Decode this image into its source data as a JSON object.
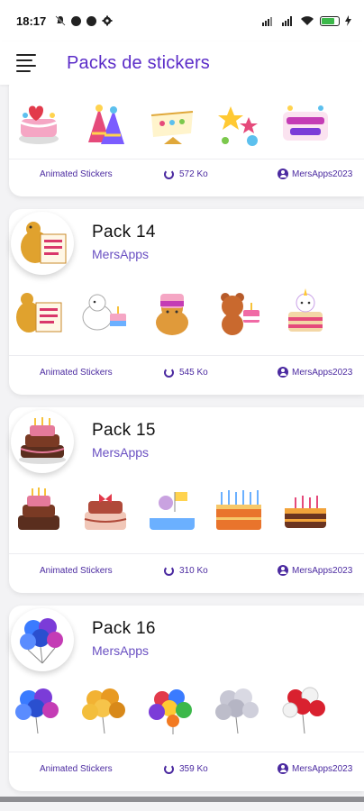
{
  "status_bar": {
    "time": "18:17"
  },
  "app_bar": {
    "title": "Packs de stickers"
  },
  "packs": [
    {
      "title": "",
      "author": "",
      "type": "Animated Stickers",
      "size": "572 Ko",
      "publisher": "MersApps2023"
    },
    {
      "title": "Pack 14",
      "author": "MersApps",
      "type": "Animated Stickers",
      "size": "545 Ko",
      "publisher": "MersApps2023"
    },
    {
      "title": "Pack 15",
      "author": "MersApps",
      "type": "Animated Stickers",
      "size": "310 Ko",
      "publisher": "MersApps2023"
    },
    {
      "title": "Pack 16",
      "author": "MersApps",
      "type": "Animated Stickers",
      "size": "359 Ko",
      "publisher": "MersApps2023"
    }
  ],
  "colors": {
    "accent": "#5b2cc8",
    "meta": "#4b2aa0",
    "author": "#6a50c2"
  },
  "icons": {
    "menu": "menu-icon",
    "size": "loading-ring-icon",
    "publisher": "user-circle-icon"
  }
}
